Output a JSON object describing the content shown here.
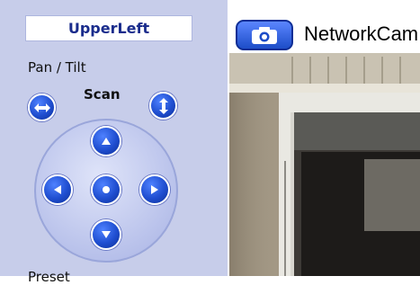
{
  "preset": {
    "value": "UpperLeft"
  },
  "pan_tilt": {
    "label": "Pan / Tilt",
    "scan_label": "Scan"
  },
  "camera": {
    "title": "NetworkCam"
  },
  "bottom": {
    "label_cut": "Preset"
  },
  "colors": {
    "panel": "#c7cdea",
    "button_blue": "#1f4ed0",
    "preset_text": "#1a2c8c"
  },
  "icons": {
    "horizontal_scan": "left-right-arrows-icon",
    "vertical_scan": "up-down-arrows-icon",
    "snapshot": "camera-icon",
    "up": "triangle-up-icon",
    "down": "triangle-down-icon",
    "left": "triangle-left-icon",
    "right": "triangle-right-icon",
    "home": "dot-icon"
  }
}
